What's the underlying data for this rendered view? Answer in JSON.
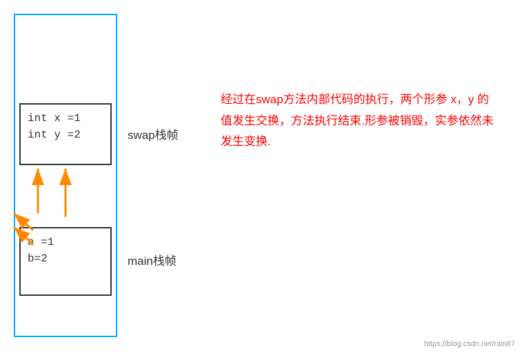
{
  "stack": {
    "outer_border_color": "#00aaff",
    "swap_frame": {
      "line1": "int x =1",
      "line2": "int y =2"
    },
    "main_frame": {
      "line1": "a =1",
      "line2": "b=2"
    },
    "swap_label": "swap栈帧",
    "main_label": "main栈帧"
  },
  "description": {
    "text": "经过在swap方法内部代码的执行，两个形参 x，y 的值发生交换，方法执行结束.形参被销毁，实参依然未发生变换."
  },
  "watermark": {
    "text": "https://blog.csdn.net/rain67"
  },
  "arrows": {
    "color": "#ff8800"
  }
}
